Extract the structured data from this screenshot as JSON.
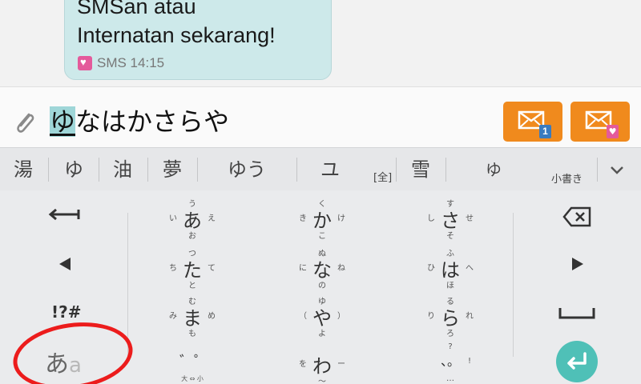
{
  "chat": {
    "message_lines": [
      "SMSan atau",
      "Internatan sekarang!"
    ],
    "meta_icon": "sms-heart-icon",
    "meta_text": "SMS 14:15"
  },
  "compose": {
    "attach_icon": "paperclip-icon",
    "highlighted_char": "ゆ",
    "text_rest": "なはかさらや",
    "send_button_1": {
      "icon": "send-sim1-icon",
      "badge": "1"
    },
    "send_button_2": {
      "icon": "send-heart-icon",
      "badge": "♥"
    }
  },
  "candidates": {
    "items": [
      "湯",
      "ゆ",
      "油",
      "夢",
      "ゆう",
      "ユ",
      "雪",
      "ゆ"
    ],
    "full_width_tag": "[全]",
    "small_label": "小書き",
    "expand_icon": "chevron-down-icon"
  },
  "keyboard": {
    "left_column": {
      "backspace_left_icon": "arrow-left-icon",
      "cursor_left_icon": "triangle-left-icon",
      "symbols_label": "!?#",
      "mode_main": "あ",
      "mode_alt": "a"
    },
    "right_column": {
      "delete_icon": "backspace-icon",
      "cursor_right_icon": "triangle-right-icon",
      "space_icon": "space-icon",
      "enter_icon": "enter-icon"
    },
    "keys": [
      {
        "center": "あ",
        "top": "う",
        "left": "い",
        "right": "え",
        "bottom": "お"
      },
      {
        "center": "か",
        "top": "く",
        "left": "き",
        "right": "け",
        "bottom": "こ"
      },
      {
        "center": "さ",
        "top": "す",
        "left": "し",
        "right": "せ",
        "bottom": "そ"
      },
      {
        "center": "た",
        "top": "つ",
        "left": "ち",
        "right": "て",
        "bottom": "と"
      },
      {
        "center": "な",
        "top": "ぬ",
        "left": "に",
        "right": "ね",
        "bottom": "の"
      },
      {
        "center": "は",
        "top": "ふ",
        "left": "ひ",
        "right": "へ",
        "bottom": "ほ"
      },
      {
        "center": "ま",
        "top": "む",
        "left": "み",
        "right": "め",
        "bottom": "も"
      },
      {
        "center": "や",
        "top": "ゆ",
        "left": "（",
        "right": "）",
        "bottom": "よ"
      },
      {
        "center": "ら",
        "top": "る",
        "left": "り",
        "right": "れ",
        "bottom": "ろ"
      },
      {
        "center": "゛゜",
        "top": "",
        "left": "",
        "right": "",
        "bottom": "大 ⇔ 小"
      },
      {
        "center": "わ",
        "top": "",
        "left": "を",
        "right": "ー",
        "bottom": "〜"
      },
      {
        "center": "、。",
        "top": "?",
        "left": "",
        "right": "!",
        "bottom": "…"
      }
    ]
  },
  "annotation": {
    "color": "#ec1c1c"
  }
}
